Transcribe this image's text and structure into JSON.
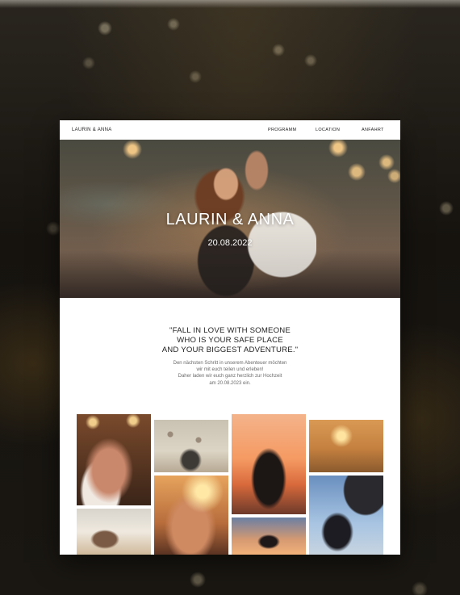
{
  "nav": {
    "brand": "LAURIN & ANNA",
    "items": [
      {
        "label": "PROGRAMM"
      },
      {
        "label": "LOCATION"
      },
      {
        "label": "ANFAHRT"
      }
    ]
  },
  "hero": {
    "title": "LAURIN & ANNA",
    "date": "20.08.2022"
  },
  "quote": {
    "line1": "\"FALL IN LOVE WITH SOMEONE",
    "line2": "WHO IS YOUR SAFE PLACE",
    "line3": "AND YOUR BIGGEST ADVENTURE.\""
  },
  "invite": {
    "line1": "Den nächsten Schritt in unserem Abenteuer möchten",
    "line2": "wir mit euch teilen und erleben!",
    "line3": "Daher laden wir euch ganz herzlich zur Hochzeit",
    "line4": "am 20.08.2023 ein."
  },
  "gallery": {
    "photos": [
      {
        "alt": "couple-bokeh-lights"
      },
      {
        "alt": "couple-hot-air-balloons"
      },
      {
        "alt": "couple-sunset-beach-selfie"
      },
      {
        "alt": "paddleboard-sunset"
      },
      {
        "alt": "couple-on-beach"
      },
      {
        "alt": "couple-golden-light"
      },
      {
        "alt": "holding-hands-sunset"
      },
      {
        "alt": "couple-drinks-car-sunset"
      }
    ]
  },
  "colors": {
    "background": "#1b1813",
    "card": "#ffffff",
    "text": "#1f1f1f",
    "muted": "#6a6a6a"
  }
}
